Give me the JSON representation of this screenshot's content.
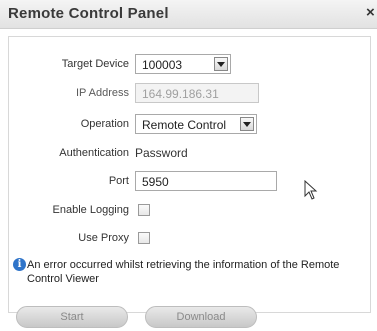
{
  "window": {
    "title": "Remote Control Panel",
    "close_glyph": "×"
  },
  "form": {
    "target_device": {
      "label": "Target Device",
      "value": "100003"
    },
    "ip_address": {
      "label": "IP Address",
      "value": "164.99.186.31"
    },
    "operation": {
      "label": "Operation",
      "value": "Remote Control"
    },
    "authentication": {
      "label": "Authentication",
      "value": "Password"
    },
    "port": {
      "label": "Port",
      "value": "5950"
    },
    "enable_logging": {
      "label": "Enable Logging",
      "checked": false
    },
    "use_proxy": {
      "label": "Use Proxy",
      "checked": false
    }
  },
  "message": {
    "icon": "info-icon",
    "icon_glyph": "i",
    "text": "An error occurred whilst retrieving the information of the Remote Control Viewer"
  },
  "buttons": {
    "start": "Start",
    "download": "Download"
  },
  "colors": {
    "info_icon": "#2f74c9",
    "title_text": "#3a3a3a"
  }
}
